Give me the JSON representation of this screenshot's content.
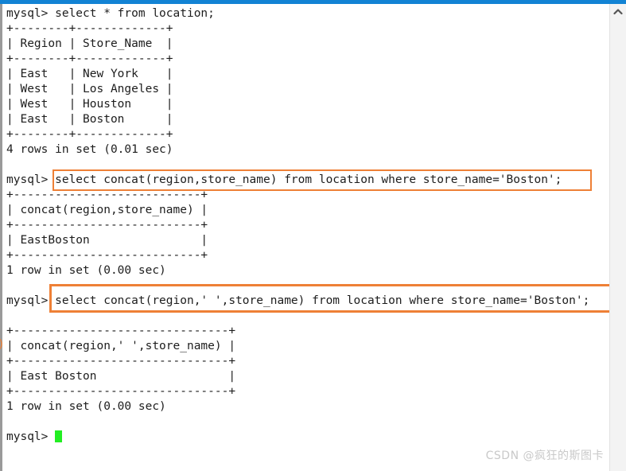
{
  "window": {
    "titlebar_color": "#1283d4",
    "background": "#ffffff",
    "text_color": "#1d1d1d"
  },
  "terminal": {
    "prompt": "mysql>",
    "cursor_color": "#22ee22",
    "highlight_color": "#ee8036",
    "lines": [
      "mysql> select * from location;",
      "+--------+-------------+",
      "| Region | Store_Name  |",
      "+--------+-------------+",
      "| East   | New York    |",
      "| West   | Los Angeles |",
      "| West   | Houston     |",
      "| East   | Boston      |",
      "+--------+-------------+",
      "4 rows in set (0.01 sec)",
      "",
      "mysql> select concat(region,store_name) from location where store_name='Boston';",
      "+---------------------------+",
      "| concat(region,store_name) |",
      "+---------------------------+",
      "| EastBoston                |",
      "+---------------------------+",
      "1 row in set (0.00 sec)",
      "",
      "mysql> select concat(region,' ',store_name) from location where store_name='Boston';",
      "",
      "+-------------------------------+",
      "| concat(region,' ',store_name) |",
      "+-------------------------------+",
      "| East Boston                   |",
      "+-------------------------------+",
      "1 row in set (0.00 sec)",
      "",
      "mysql> "
    ]
  },
  "queries": [
    {
      "id": "query-1",
      "sql": "select * from location;",
      "result_rows": 4,
      "duration": "0.01 sec",
      "status": "4 rows in set (0.01 sec)",
      "columns": [
        "Region",
        "Store_Name"
      ],
      "rows": [
        [
          "East",
          "New York"
        ],
        [
          "West",
          "Los Angeles"
        ],
        [
          "West",
          "Houston"
        ],
        [
          "East",
          "Boston"
        ]
      ],
      "highlighted": false
    },
    {
      "id": "query-2",
      "sql": "select concat(region,store_name) from location where store_name='Boston';",
      "result_rows": 1,
      "duration": "0.00 sec",
      "status": "1 row in set (0.00 sec)",
      "columns": [
        "concat(region,store_name)"
      ],
      "rows": [
        [
          "EastBoston"
        ]
      ],
      "highlighted": true
    },
    {
      "id": "query-3",
      "sql": "select concat(region,' ',store_name) from location where store_name='Boston';",
      "result_rows": 1,
      "duration": "0.00 sec",
      "status": "1 row in set (0.00 sec)",
      "columns": [
        "concat(region,' ',store_name)"
      ],
      "rows": [
        [
          "East Boston"
        ]
      ],
      "highlighted": true
    }
  ],
  "scrollbar": {
    "up_arrow_icon": "chevron-up-icon",
    "track_color": "#f3f3f3"
  },
  "watermark": {
    "text": "CSDN @疯狂的斯图卡"
  },
  "cut_glyph": {
    "text": ")"
  }
}
